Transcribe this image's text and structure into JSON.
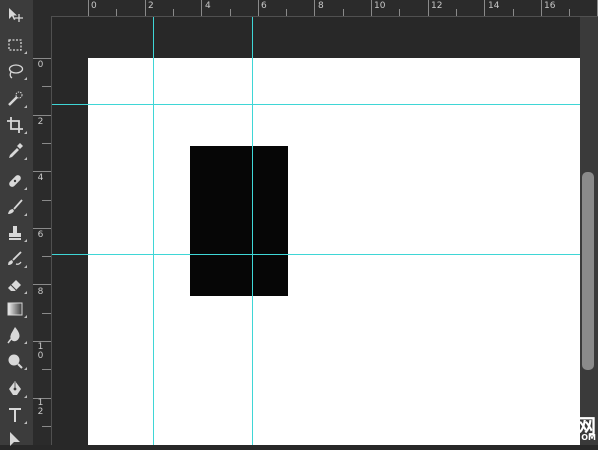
{
  "tools": [
    {
      "name": "move-tool-icon"
    },
    {
      "name": "marquee-tool-icon"
    },
    {
      "name": "lasso-tool-icon"
    },
    {
      "name": "quick-selection-tool-icon"
    },
    {
      "name": "crop-tool-icon"
    },
    {
      "name": "eyedropper-tool-icon"
    },
    {
      "name": "healing-brush-tool-icon"
    },
    {
      "name": "brush-tool-icon"
    },
    {
      "name": "clone-stamp-tool-icon"
    },
    {
      "name": "history-brush-tool-icon"
    },
    {
      "name": "eraser-tool-icon"
    },
    {
      "name": "gradient-tool-icon"
    },
    {
      "name": "blur-tool-icon"
    },
    {
      "name": "dodge-tool-icon"
    },
    {
      "name": "pen-tool-icon"
    },
    {
      "name": "type-tool-icon"
    },
    {
      "name": "path-selection-tool-icon"
    }
  ],
  "ruler": {
    "top_labels": [
      "0",
      "2",
      "4",
      "6",
      "8",
      "10",
      "12",
      "14",
      "16"
    ],
    "left_labels": [
      "0",
      "2",
      "4",
      "6",
      "8",
      "1\n0",
      "1\n2"
    ]
  },
  "colors": {
    "guide": "#3fd6d6",
    "shape_fill": "#060606",
    "canvas": "#ffffff",
    "workspace": "#282828"
  },
  "watermark": {
    "glyph": "网",
    "domain": "OM"
  }
}
